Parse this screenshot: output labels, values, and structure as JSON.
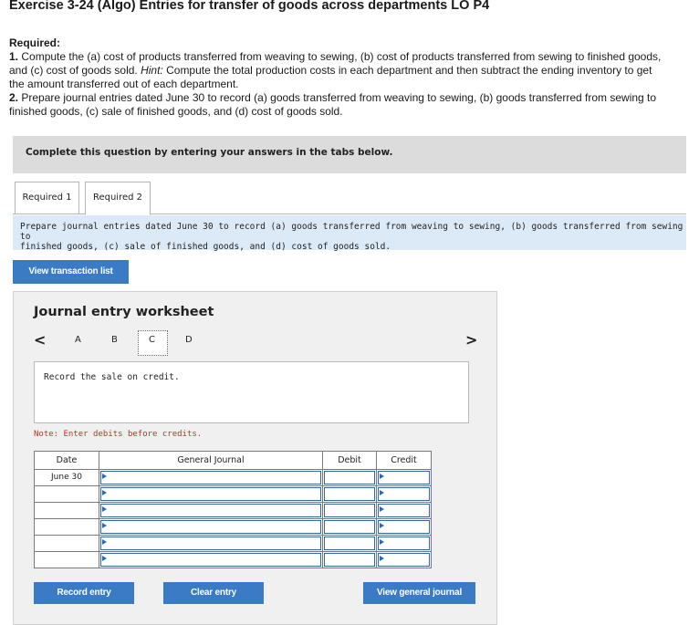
{
  "title": "Exercise 3-24 (Algo) Entries for transfer of goods across departments LO P4",
  "required": {
    "heading": "Required:",
    "item1_num": "1.",
    "item1_line1": "Compute the (a) cost of products transferred from weaving to sewing, (b) cost of products transferred from sewing to finished goods,",
    "item1_line2a": "and (c) cost of goods sold. ",
    "item1_hint": "Hint:",
    "item1_line2b": " Compute the total production costs in each department and then subtract the ending inventory to get",
    "item1_line3": "the amount transferred out of each department.",
    "item2_num": "2.",
    "item2_line1": "Prepare journal entries dated June 30 to record (a) goods transferred from weaving to sewing, (b) goods transferred from sewing to",
    "item2_line2": "finished goods, (c) sale of finished goods, and (d) cost of goods sold."
  },
  "banner_text": "Complete this question by entering your answers in the tabs below.",
  "tabs": [
    {
      "label": "Required 1"
    },
    {
      "label": "Required 2"
    }
  ],
  "instructions": {
    "line1": "Prepare journal entries dated June 30 to record (a) goods transferred from weaving to sewing, (b) goods transferred from sewing to",
    "line2": "finished goods, (c) sale of finished goods, and (d) cost of goods sold."
  },
  "view_transaction_list": "View transaction list",
  "worksheet": {
    "title": "Journal entry worksheet",
    "prev_arrow": "<",
    "next_arrow": ">",
    "nav_items": [
      "A",
      "B",
      "C",
      "D"
    ],
    "selected": "C",
    "description": "Record the sale on credit.",
    "note": "Note: Enter debits before credits.",
    "columns": {
      "date": "Date",
      "journal": "General Journal",
      "debit": "Debit",
      "credit": "Credit"
    },
    "rows": [
      {
        "date": "June 30"
      },
      {
        "date": ""
      },
      {
        "date": ""
      },
      {
        "date": ""
      },
      {
        "date": ""
      },
      {
        "date": ""
      }
    ]
  },
  "buttons": {
    "record": "Record entry",
    "clear": "Clear entry",
    "view_gj": "View general journal"
  },
  "colors": {
    "button_blue": "#3b7ac4",
    "instruction_bg": "#dce9f7",
    "note_red": "#c0302a"
  }
}
